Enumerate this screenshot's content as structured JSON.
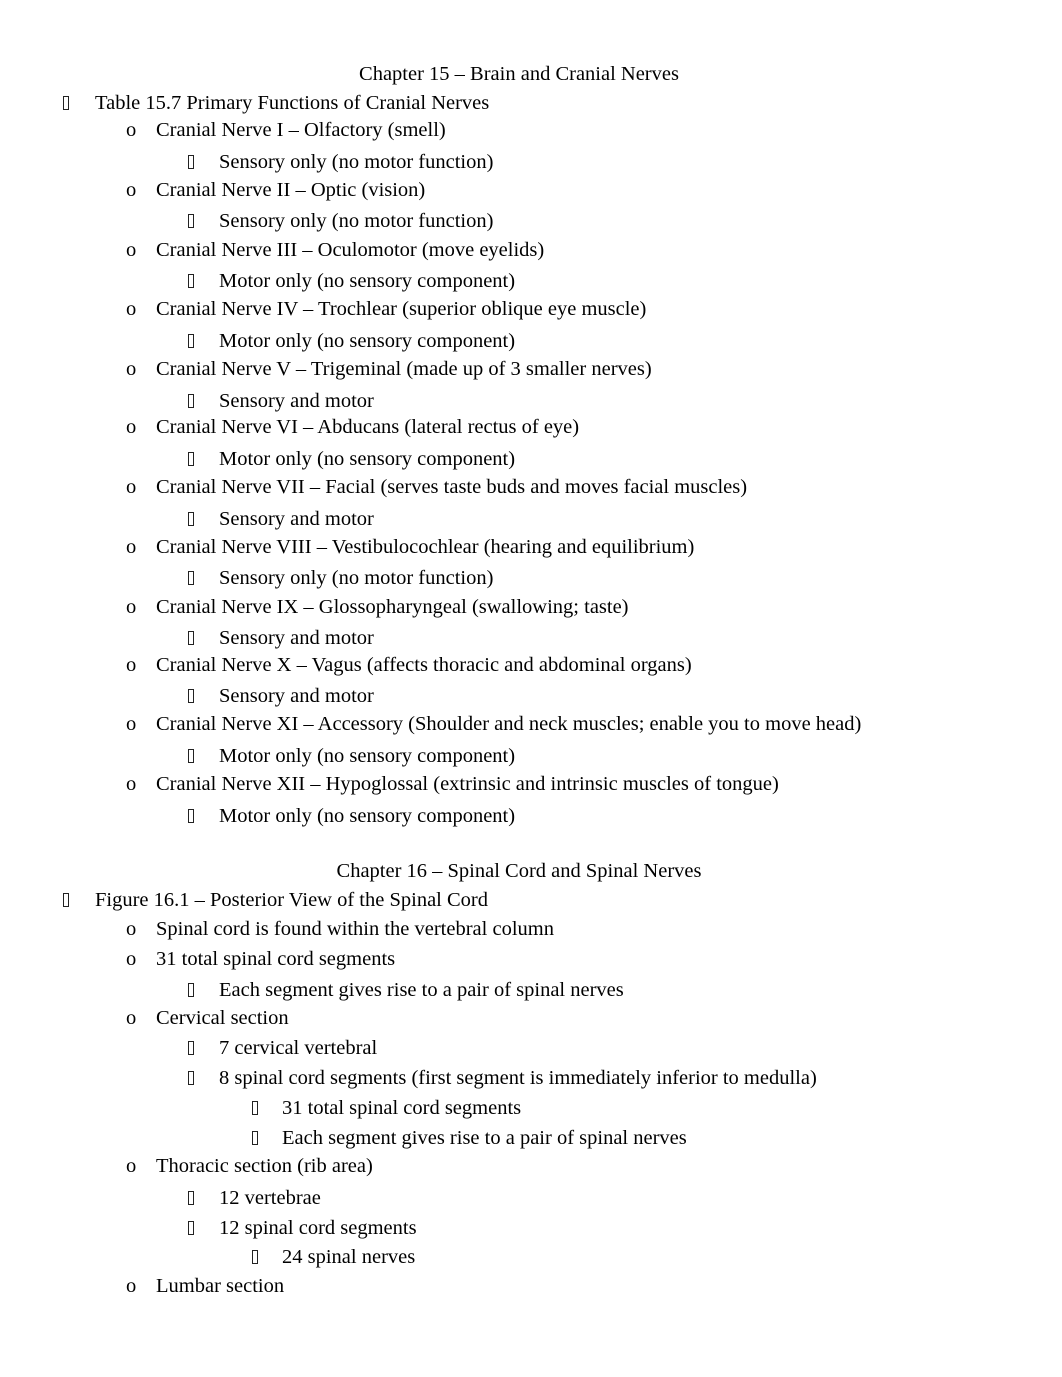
{
  "document": {
    "sections": [
      {
        "title": "Chapter 15 – Brain and Cranial Nerves",
        "items": [
          {
            "level": 1,
            "bullet": "square-bullet-icon",
            "text": "Table 15.7 Primary Functions of Cranial Nerves"
          },
          {
            "level": 2,
            "bullet": "circle-bullet-icon",
            "text": "Cranial Nerve I – Olfactory (smell)"
          },
          {
            "level": 3,
            "bullet": "square-bullet-icon",
            "text": "Sensory only (no motor function)"
          },
          {
            "level": 2,
            "bullet": "circle-bullet-icon",
            "text": "Cranial Nerve II – Optic (vision)"
          },
          {
            "level": 3,
            "bullet": "square-bullet-icon",
            "text": "Sensory only (no motor function)"
          },
          {
            "level": 2,
            "bullet": "circle-bullet-icon",
            "text": "Cranial Nerve III – Oculomotor (move eyelids)"
          },
          {
            "level": 3,
            "bullet": "square-bullet-icon",
            "text": "Motor only (no sensory component)"
          },
          {
            "level": 2,
            "bullet": "circle-bullet-icon",
            "text": "Cranial Nerve IV – Trochlear (superior oblique eye muscle)"
          },
          {
            "level": 3,
            "bullet": "square-bullet-icon",
            "text": "Motor only (no sensory component)"
          },
          {
            "level": 2,
            "bullet": "circle-bullet-icon",
            "text": "Cranial Nerve V – Trigeminal (made up of 3 smaller nerves)"
          },
          {
            "level": 3,
            "bullet": "square-bullet-icon",
            "text": "Sensory and motor"
          },
          {
            "level": 2,
            "bullet": "circle-bullet-icon",
            "text": "Cranial Nerve VI – Abducans (lateral rectus of eye)"
          },
          {
            "level": 3,
            "bullet": "square-bullet-icon",
            "text": "Motor only (no sensory component)"
          },
          {
            "level": 2,
            "bullet": "circle-bullet-icon",
            "text": "Cranial Nerve VII – Facial (serves taste buds and moves facial muscles)"
          },
          {
            "level": 3,
            "bullet": "square-bullet-icon",
            "text": "Sensory and motor"
          },
          {
            "level": 2,
            "bullet": "circle-bullet-icon",
            "text": "Cranial Nerve VIII – Vestibulocochlear (hearing and equilibrium)"
          },
          {
            "level": 3,
            "bullet": "square-bullet-icon",
            "text": "Sensory only (no motor function)"
          },
          {
            "level": 2,
            "bullet": "circle-bullet-icon",
            "text": "Cranial Nerve IX – Glossopharyngeal (swallowing; taste)"
          },
          {
            "level": 3,
            "bullet": "square-bullet-icon",
            "text": "Sensory and motor"
          },
          {
            "level": 2,
            "bullet": "circle-bullet-icon",
            "text": "Cranial Nerve X – Vagus (affects thoracic and abdominal organs)"
          },
          {
            "level": 3,
            "bullet": "square-bullet-icon",
            "text": "Sensory and motor"
          },
          {
            "level": 2,
            "bullet": "circle-bullet-icon",
            "text": "Cranial Nerve XI – Accessory (Shoulder and neck muscles; enable you to move head)"
          },
          {
            "level": 3,
            "bullet": "square-bullet-icon",
            "text": "Motor only (no sensory component)"
          },
          {
            "level": 2,
            "bullet": "circle-bullet-icon",
            "text": "Cranial Nerve XII – Hypoglossal (extrinsic and intrinsic muscles of tongue)"
          },
          {
            "level": 3,
            "bullet": "square-bullet-icon",
            "text": "Motor only (no sensory component)"
          }
        ]
      },
      {
        "title": "Chapter 16 – Spinal Cord and Spinal Nerves",
        "items": [
          {
            "level": 1,
            "bullet": "square-bullet-icon",
            "text": "Figure 16.1 – Posterior View of the Spinal Cord"
          },
          {
            "level": 2,
            "bullet": "circle-bullet-icon",
            "text": "Spinal cord is found within the vertebral column"
          },
          {
            "level": 2,
            "bullet": "circle-bullet-icon",
            "text": "31 total spinal cord segments"
          },
          {
            "level": 3,
            "bullet": "square-bullet-icon",
            "text": "Each segment gives rise to a pair of spinal nerves"
          },
          {
            "level": 2,
            "bullet": "circle-bullet-icon",
            "text": "Cervical section"
          },
          {
            "level": 3,
            "bullet": "square-bullet-icon",
            "text": "7 cervical vertebral"
          },
          {
            "level": 3,
            "bullet": "square-bullet-icon",
            "text": "8 spinal cord segments (first segment is immediately inferior to medulla)"
          },
          {
            "level": 4,
            "bullet": "square-bullet-icon",
            "text": "31 total spinal cord segments"
          },
          {
            "level": 4,
            "bullet": "square-bullet-icon",
            "text": "Each segment gives rise to a pair of spinal nerves"
          },
          {
            "level": 2,
            "bullet": "circle-bullet-icon",
            "text": "Thoracic section (rib area)"
          },
          {
            "level": 3,
            "bullet": "square-bullet-icon",
            "text": "12 vertebrae"
          },
          {
            "level": 3,
            "bullet": "square-bullet-icon",
            "text": "12 spinal cord segments"
          },
          {
            "level": 4,
            "bullet": "square-bullet-icon",
            "text": "24 spinal nerves"
          },
          {
            "level": 2,
            "bullet": "circle-bullet-icon",
            "text": "Lumbar section"
          }
        ]
      }
    ],
    "circle_bullet_char": "o"
  }
}
